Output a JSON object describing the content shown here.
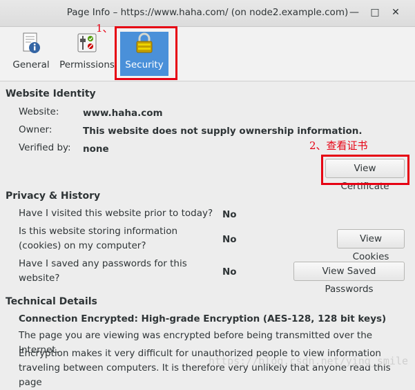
{
  "window": {
    "title": "Page Info – https://www.haha.com/ (on node2.example.com)",
    "minimize_glyph": "—",
    "maximize_glyph": "□",
    "close_glyph": "✕"
  },
  "tabs": [
    {
      "label": "General",
      "icon": "info-page-icon"
    },
    {
      "label": "Permissions",
      "icon": "permissions-toggle-icon"
    },
    {
      "label": "Security",
      "icon": "padlock-icon",
      "selected": true
    }
  ],
  "annotations": {
    "step1": "1、",
    "step2": "2、查看证书"
  },
  "identity": {
    "heading": "Website Identity",
    "website_label": "Website:",
    "website_value": "www.haha.com",
    "owner_label": "Owner:",
    "owner_value": "This website does not supply ownership information.",
    "verified_label": "Verified by:",
    "verified_value": "none",
    "view_cert": "View Certificate"
  },
  "privacy": {
    "heading": "Privacy & History",
    "q1": "Have I visited this website prior to today?",
    "a1": "No",
    "q2_line1": "Is this website storing information",
    "q2_line2": "(cookies) on my computer?",
    "a2": "No",
    "view_cookies": "View Cookies",
    "q3_line1": "Have I saved any passwords for this",
    "q3_line2": "website?",
    "a3": "No",
    "view_passwords": "View Saved Passwords"
  },
  "technical": {
    "heading": "Technical Details",
    "conn": "Connection Encrypted: High-grade Encryption (AES-128, 128 bit keys)",
    "p1": "The page you are viewing was encrypted before being transmitted over the Internet.",
    "p2_line1": "Encryption makes it very difficult for unauthorized people to view information",
    "p2_line2": "traveling between computers. It is therefore very unlikely that anyone read this page"
  },
  "watermark": "https://blog.csdn.net/ying_smile",
  "colors": {
    "accent": "#4a90d9",
    "annotation_red": "#e60012"
  }
}
